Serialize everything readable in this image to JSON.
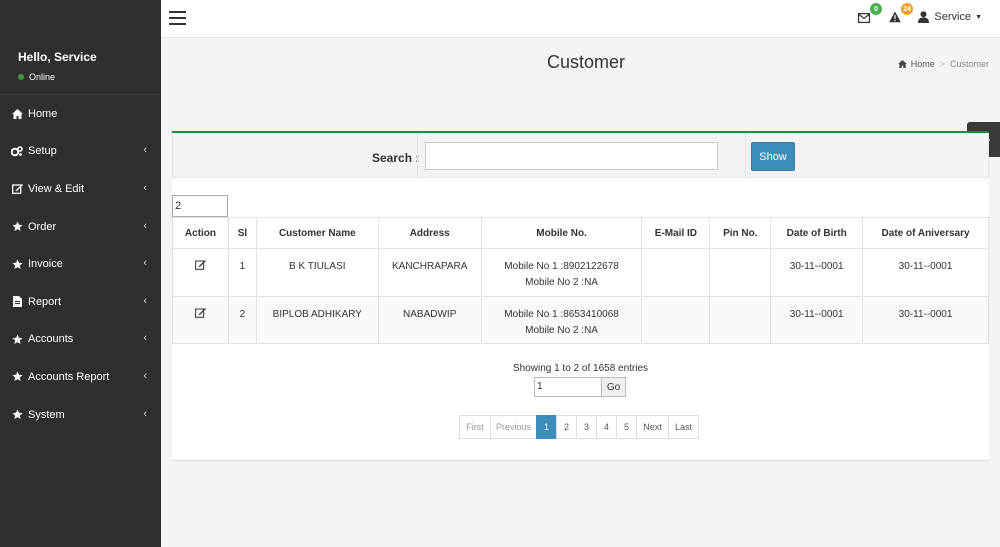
{
  "sidebar": {
    "greeting": "Hello, Service",
    "status": "Online",
    "items": [
      {
        "label": "Home",
        "icon": "home-icon",
        "chevron": false
      },
      {
        "label": "Setup",
        "icon": "cogs-icon",
        "chevron": true
      },
      {
        "label": "View & Edit",
        "icon": "edit-icon",
        "chevron": true
      },
      {
        "label": "Order",
        "icon": "star-icon",
        "chevron": true
      },
      {
        "label": "Invoice",
        "icon": "star-icon",
        "chevron": true
      },
      {
        "label": "Report",
        "icon": "file-icon",
        "chevron": true
      },
      {
        "label": "Accounts",
        "icon": "star-icon",
        "chevron": true
      },
      {
        "label": "Accounts Report",
        "icon": "star-icon",
        "chevron": true
      },
      {
        "label": "System",
        "icon": "star-icon",
        "chevron": true
      }
    ]
  },
  "header": {
    "messages_count": "0",
    "alerts_count": "24",
    "user_label": "Service",
    "colors": {
      "messages_badge": "#4caf50",
      "alerts_badge": "#f0a030"
    }
  },
  "page": {
    "title": "Customer",
    "breadcrumb_home": "Home",
    "breadcrumb_current": "Customer"
  },
  "search": {
    "label": "Search :",
    "value": "",
    "button": "Show"
  },
  "entries_per_page": "2",
  "table": {
    "headers": [
      "Action",
      "Sl",
      "Customer Name",
      "Address",
      "Mobile No.",
      "E-Mail ID",
      "Pin No.",
      "Date of Birth",
      "Date of Aniversary"
    ],
    "rows": [
      {
        "sl": "1",
        "name": "B K TIULASI",
        "address": "KANCHRAPARA",
        "mobile1": "Mobile No 1 :8902122678",
        "mobile2": "Mobile No 2 :NA",
        "email": "",
        "pin": "",
        "dob": "30-11--0001",
        "anniversary": "30-11--0001"
      },
      {
        "sl": "2",
        "name": "BIPLOB ADHIKARY",
        "address": "NABADWIP",
        "mobile1": "Mobile No 1 :8653410068",
        "mobile2": "Mobile No 2 :NA",
        "email": "",
        "pin": "",
        "dob": "30-11--0001",
        "anniversary": "30-11--0001"
      }
    ]
  },
  "footer": {
    "showing": "Showing 1 to 2 of 1658 entries",
    "goto_value": "1",
    "go_button": "Go"
  },
  "pagination": {
    "first": "First",
    "previous": "Previous",
    "pages": [
      "1",
      "2",
      "3",
      "4",
      "5"
    ],
    "active_page": "1",
    "next": "Next",
    "last": "Last"
  },
  "colors": {
    "sidebar_bg": "#2f2f2f",
    "accent": "#3c8dbc",
    "box_top_border": "#1f8a46"
  }
}
